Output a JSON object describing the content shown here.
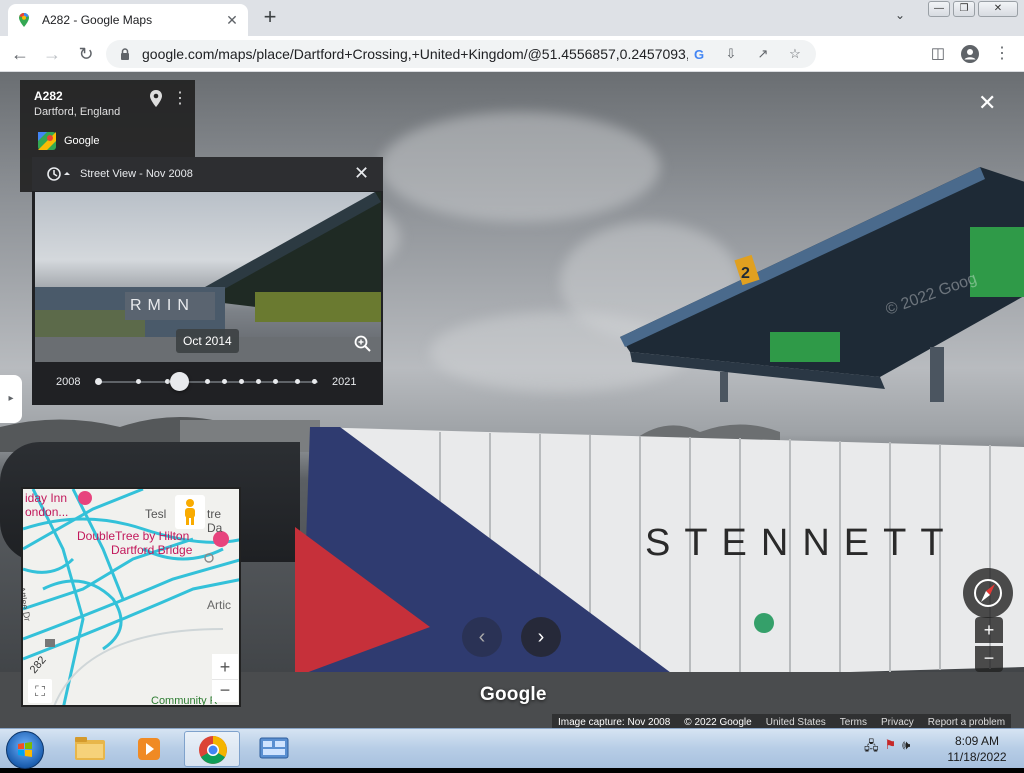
{
  "browser": {
    "tab_title": "A282 - Google Maps",
    "tab_close": "✕",
    "new_tab": "+",
    "url": "google.com/maps/place/Dartford+Crossing,+United+Kingdom/@51.4556857,0.2457093,3a,75y,319.2..."
  },
  "place_card": {
    "title": "A282",
    "subtitle": "Dartford, England",
    "provider": "Google"
  },
  "time_travel": {
    "header": "Street View - Nov 2008",
    "tooltip": "Oct 2014",
    "start_year": "2008",
    "end_year": "2021",
    "selected_position": 0.37
  },
  "minimap": {
    "labels": [
      "iday Inn",
      "ondon...",
      "Tesl",
      "tre Da",
      "DoubleTree by Hilton",
      "Dartford Bridge",
      "Artic",
      "Community R",
      "Attlee Dr",
      "282"
    ]
  },
  "streetview": {
    "close": "✕",
    "zoom_in": "+",
    "zoom_out": "−",
    "logo": "Google",
    "trailer_text": "STENNETT",
    "canopy_text": "© 2022 Goog",
    "lane_number": "2",
    "preview_text": "RMIN",
    "footer": {
      "capture": "Image capture: Nov 2008",
      "copyright": "© 2022 Google",
      "country": "United States",
      "terms": "Terms",
      "privacy": "Privacy",
      "report": "Report a problem"
    }
  },
  "taskbar": {
    "time": "8:09 AM",
    "date": "11/18/2022"
  }
}
